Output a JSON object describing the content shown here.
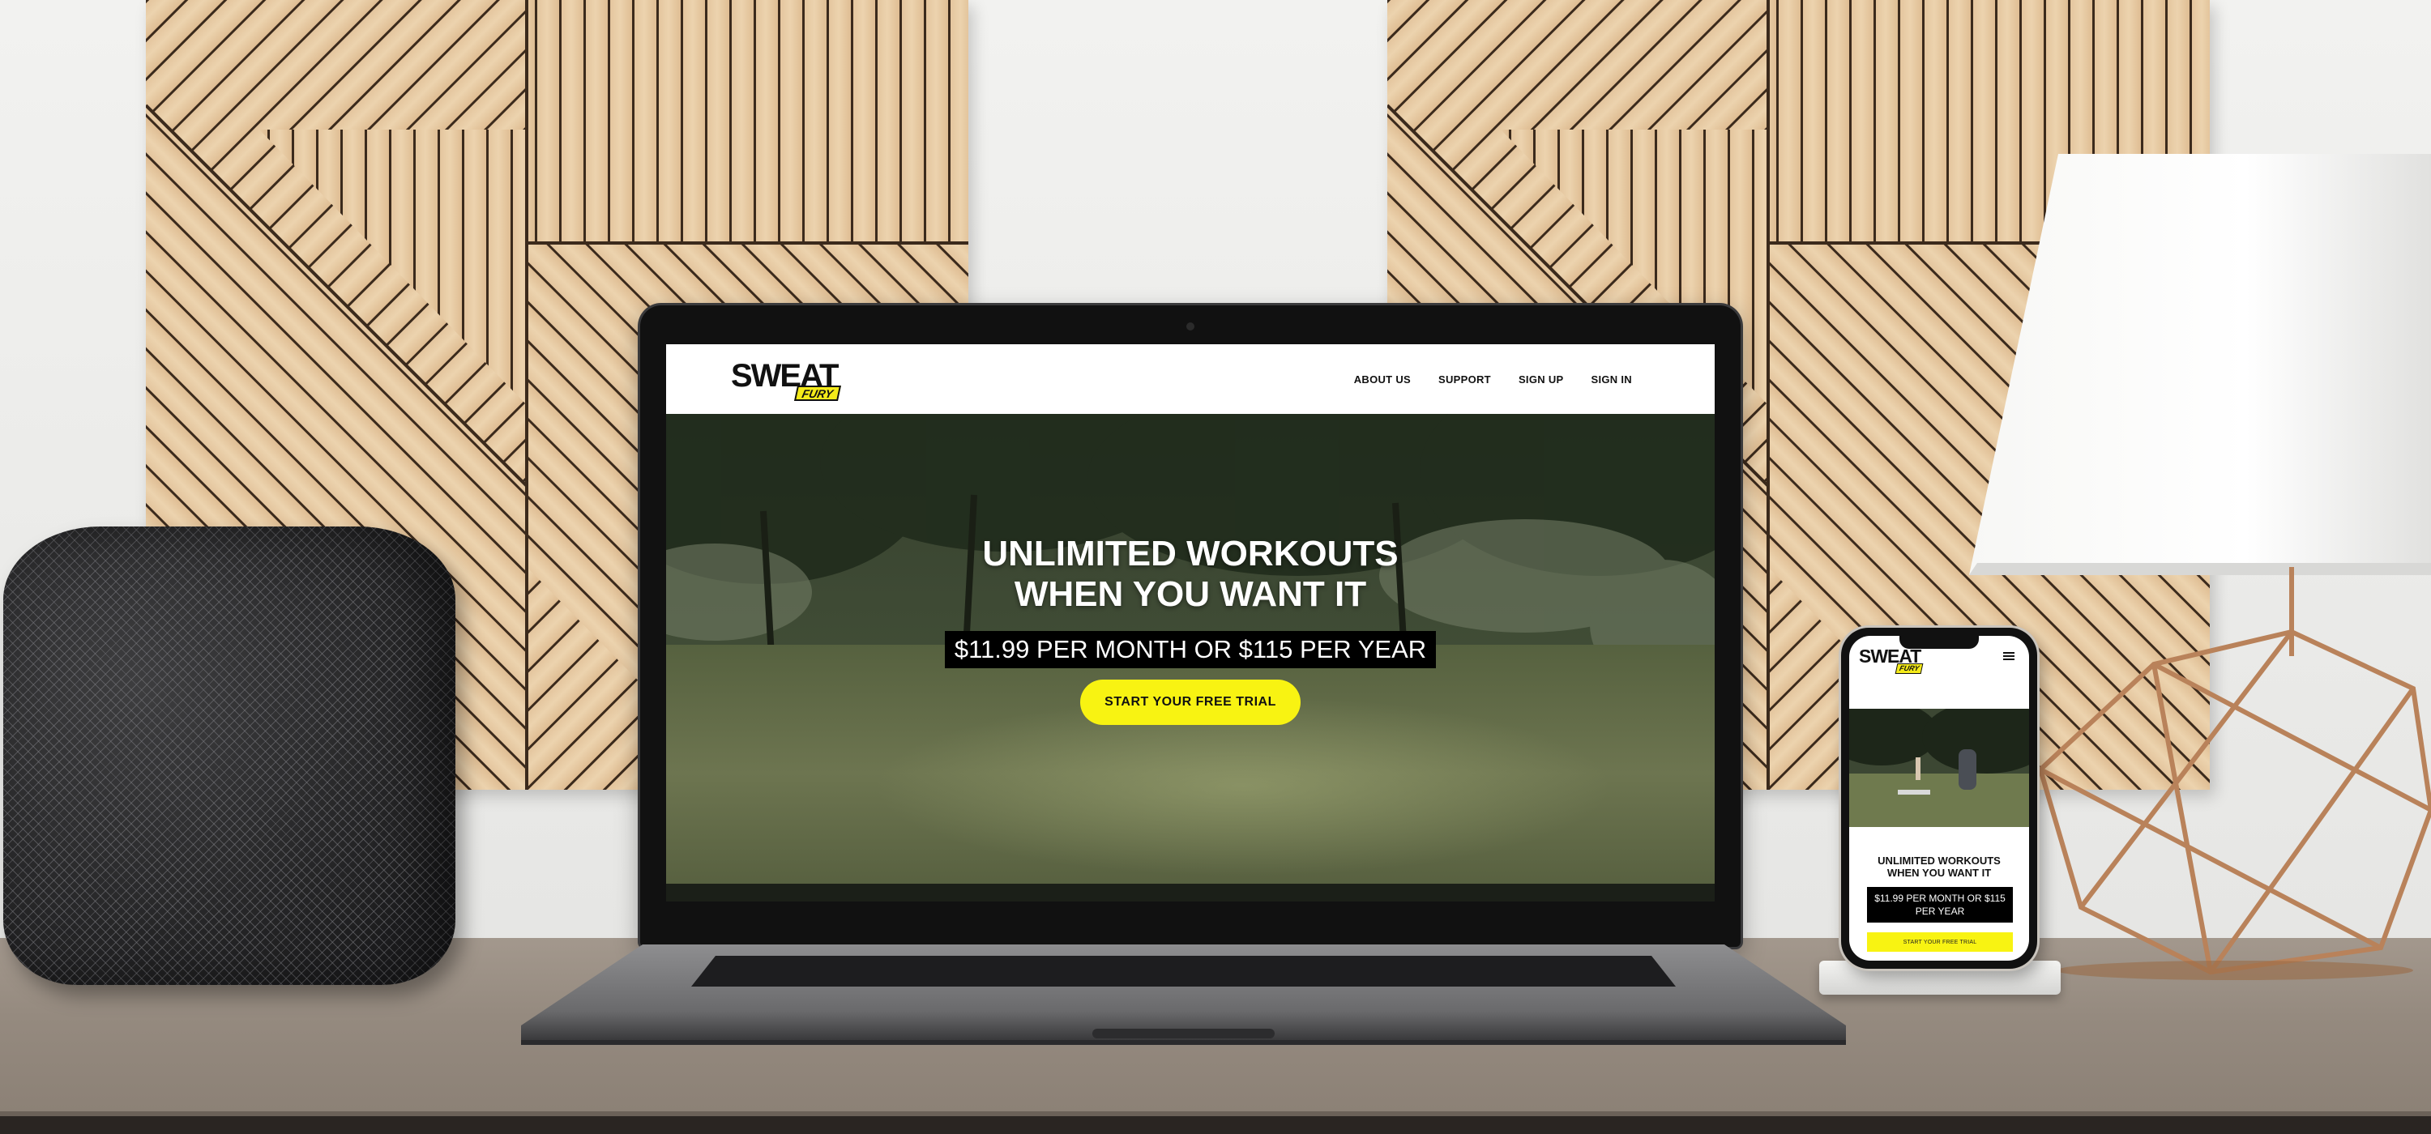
{
  "site": {
    "logo": {
      "wordmark": "SWEAT",
      "tag": "FURY"
    },
    "nav": [
      {
        "label": "ABOUT US"
      },
      {
        "label": "SUPPORT"
      },
      {
        "label": "SIGN UP"
      },
      {
        "label": "SIGN IN"
      }
    ],
    "hero": {
      "title": "UNLIMITED WORKOUTS\nWHEN YOU WANT IT",
      "price": "$11.99 PER MONTH OR $115 PER YEAR",
      "cta_label": "START YOUR FREE TRIAL"
    }
  },
  "mobile": {
    "logo": {
      "wordmark": "SWEAT",
      "tag": "FURY"
    },
    "menu_icon": "hamburger-menu-icon",
    "title": "UNLIMITED WORKOUTS\nWHEN YOU WANT IT",
    "price": "$11.99 PER MONTH OR $115 PER YEAR",
    "cta_label": "START YOUR FREE TRIAL"
  },
  "colors": {
    "brand_yellow": "#f8f312",
    "header_bg": "#ffffff",
    "price_bg": "#000000",
    "text_dark": "#111111"
  }
}
